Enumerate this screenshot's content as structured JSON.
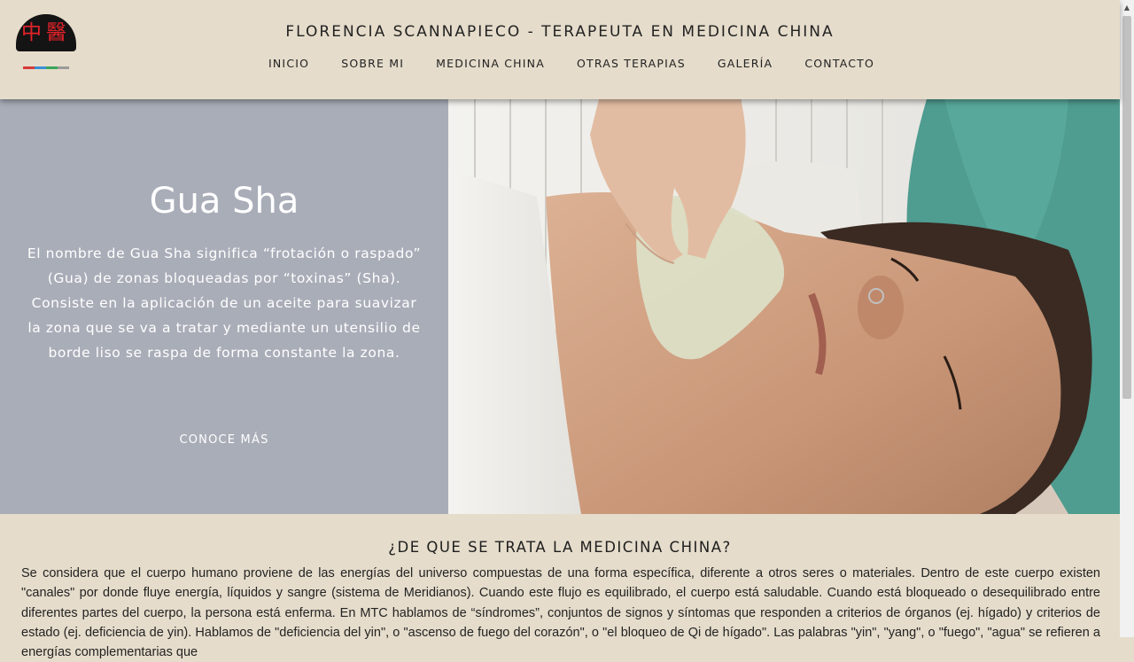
{
  "header": {
    "title": "FLORENCIA SCANNAPIECO - TERAPEUTA EN MEDICINA CHINA",
    "logo": {
      "characters": [
        "中",
        "醫"
      ],
      "line_colors": [
        "#d63a3a",
        "#3a8fd6",
        "#3aa65a",
        "#e0a020"
      ]
    },
    "nav": [
      {
        "label": "INICIO"
      },
      {
        "label": "SOBRE MI"
      },
      {
        "label": "MEDICINA CHINA"
      },
      {
        "label": "OTRAS TERAPIAS"
      },
      {
        "label": "GALERÍA"
      },
      {
        "label": "CONTACTO"
      }
    ]
  },
  "hero": {
    "title": "Gua Sha",
    "text": "El nombre de Gua Sha significa “frotación o raspado” (Gua) de zonas bloqueadas por “toxinas” (Sha). Consiste en la aplicación de un aceite para suavizar la zona que se va a tratar y mediante un utensilio de borde liso se raspa de forma constante la zona.",
    "cta": "CONOCE MÁS",
    "panel_color": "#a9adb8"
  },
  "section": {
    "title": "¿DE QUE SE TRATA LA MEDICINA CHINA?",
    "text": "Se considera que el cuerpo humano proviene de las energías del universo compuestas de una forma específica, diferente a otros seres o materiales. Dentro de este cuerpo existen \"canales\" por donde fluye energía, líquidos y sangre (sistema de Meridianos). Cuando este flujo es equilibrado, el cuerpo está saludable. Cuando está bloqueado o desequilibrado entre diferentes partes del cuerpo, la persona está enferma. En MTC hablamos de “síndromes”, conjuntos de signos y síntomas que responden a criterios de órganos (ej. hígado) y criterios de estado (ej. deficiencia de yin). Hablamos de \"deficiencia del yin\", o \"ascenso de fuego del corazón\", o \"el bloqueo de Qi de hígado\". Las palabras \"yin\", \"yang\", o \"fuego\", \"agua\" se refieren a energías complementarias que"
  },
  "colors": {
    "background": "#e5dccb",
    "hero_panel": "#a9adb8",
    "text": "#1e1e1e"
  }
}
